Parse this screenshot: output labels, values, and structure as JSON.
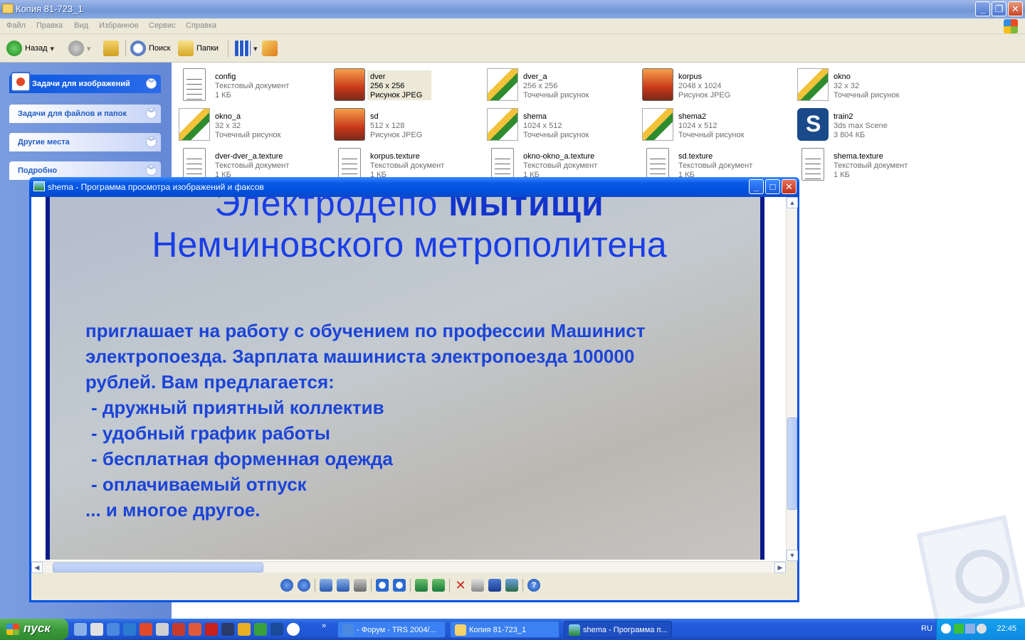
{
  "explorer": {
    "title": "Копия 81-723_1",
    "menu": [
      "Файл",
      "Правка",
      "Вид",
      "Избранное",
      "Сервис",
      "Справка"
    ],
    "toolbar": {
      "back": "Назад",
      "search": "Поиск",
      "folders": "Папки"
    },
    "taskpane": {
      "panels": [
        "Задачи для изображений",
        "Задачи для файлов и папок",
        "Другие места",
        "Подробно"
      ]
    },
    "files": [
      {
        "name": "config",
        "l1": "Текстовый документ",
        "l2": "1 КБ",
        "icon": "text-file-icon"
      },
      {
        "name": "dver",
        "l1": "256 x 256",
        "l2": "Рисунок JPEG",
        "icon": "jpeg-file-icon"
      },
      {
        "name": "dver_a",
        "l1": "256 x 256",
        "l2": "Точечный рисунок",
        "icon": "bitmap-file-icon"
      },
      {
        "name": "korpus",
        "l1": "2048 x 1024",
        "l2": "Рисунок JPEG",
        "icon": "jpeg-file-icon"
      },
      {
        "name": "okno",
        "l1": "32 x 32",
        "l2": "Точечный рисунок",
        "icon": "bitmap-file-icon"
      },
      {
        "name": "okno_a",
        "l1": "32 x 32",
        "l2": "Точечный рисунок",
        "icon": "bitmap-file-icon"
      },
      {
        "name": "sd",
        "l1": "512 x 128",
        "l2": "Рисунок JPEG",
        "icon": "jpeg-file-icon"
      },
      {
        "name": "shema",
        "l1": "1024 x 512",
        "l2": "Точечный рисунок",
        "icon": "bitmap-file-icon"
      },
      {
        "name": "shema2",
        "l1": "1024 x 512",
        "l2": "Точечный рисунок",
        "icon": "bitmap-file-icon"
      },
      {
        "name": "train2",
        "l1": "3ds max Scene",
        "l2": "3 804 КБ",
        "icon": "3dsmax-file-icon"
      },
      {
        "name": "dver-dver_a.texture",
        "l1": "Текстовый документ",
        "l2": "1 КБ",
        "icon": "text-file-icon"
      },
      {
        "name": "korpus.texture",
        "l1": "Текстовый документ",
        "l2": "1 КБ",
        "icon": "text-file-icon"
      },
      {
        "name": "okno-okno_a.texture",
        "l1": "Текстовый документ",
        "l2": "1 КБ",
        "icon": "text-file-icon"
      },
      {
        "name": "sd.texture",
        "l1": "Текстовый документ",
        "l2": "1 КБ",
        "icon": "text-file-icon"
      },
      {
        "name": "shema.texture",
        "l1": "Текстовый документ",
        "l2": "1 КБ",
        "icon": "text-file-icon"
      }
    ]
  },
  "viewer": {
    "title": "shema - Программа просмотра изображений и факсов",
    "slide": {
      "heading1_a": "Электродепо ",
      "heading1_b": "Мытищи",
      "heading2": "Немчиновского метрополитена",
      "line1_a": "приглашает на работу с обучением по профессии ",
      "line1_b": "Машинист",
      "line2": "электропоезда. Зарплата машиниста электропоезда 100000",
      "line3": "рублей. Вам предлагается:",
      "bullets": [
        "- дружный приятный коллектив",
        "- удобный график работы",
        "- бесплатная форменная одежда",
        "- оплачиваемый отпуск"
      ],
      "footer": "... и многое другое."
    }
  },
  "taskbar": {
    "start": "пуск",
    "tasks": [
      "- Форум - TRS 2004/...",
      "Копия 81-723_1",
      "shema - Программа п..."
    ],
    "lang": "RU",
    "clock": "22:45"
  },
  "colors": {
    "xp_blue": "#0054e3",
    "start_green": "#3a9a3a",
    "slide_text": "#1a3ee6"
  }
}
